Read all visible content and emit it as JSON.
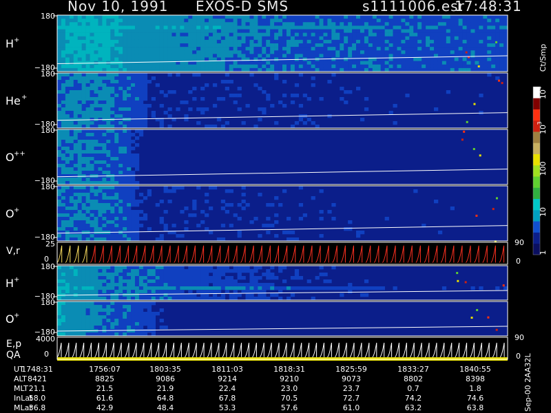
{
  "header": {
    "date": "Nov 10, 1991",
    "instrument": "EXOS-D SMS",
    "file": "s1111006.esr",
    "time": "17:48:31"
  },
  "colors": {
    "background": "#000000",
    "spectrogram_base": "#0b1e8a",
    "dropout": "#2a2aa0"
  },
  "chart_data": {
    "type": "heatmap",
    "panels": [
      {
        "id": "p1",
        "label": "H",
        "sup": "+",
        "ticks": [
          "180",
          "−180"
        ],
        "ylim": [
          -180,
          180
        ],
        "level": [
          [
            0,
            2.1
          ],
          [
            0.02,
            2.6
          ],
          [
            0.1,
            2.7
          ],
          [
            0.15,
            2.2
          ],
          [
            0.19,
            1.9
          ],
          [
            0.27,
            1.8
          ],
          [
            0.4,
            1.6
          ],
          [
            0.5,
            1.4
          ],
          [
            1,
            1.2
          ]
        ],
        "bands": [
          {
            "c": 0.11,
            "w": 0.12,
            "r0": 0.16,
            "r1": 0.67,
            "a": 1.0
          },
          {
            "c": 0.85,
            "w": 0.12,
            "r0": 0.16,
            "r1": 0.67,
            "a": 1.0
          }
        ]
      },
      {
        "id": "p2",
        "label": "He",
        "sup": "+",
        "ticks": [
          "180",
          "−180"
        ],
        "ylim": [
          -180,
          180
        ],
        "level": [
          [
            0,
            1.6
          ],
          [
            0.1,
            1.7
          ],
          [
            0.15,
            1.3
          ],
          [
            0.19,
            1.1
          ],
          [
            0.2,
            0.5
          ],
          [
            1,
            0.4
          ]
        ],
        "bands": [
          {
            "c": 0.12,
            "w": 0.11,
            "r0": 0.45,
            "r1": 0.72,
            "a": 0.8
          },
          {
            "c": 0.86,
            "w": 0.11,
            "r0": 0.45,
            "r1": 0.72,
            "a": 0.8
          }
        ]
      },
      {
        "id": "p3",
        "label": "O",
        "sup": "++",
        "ticks": [
          "180",
          "−180"
        ],
        "ylim": [
          -180,
          180
        ],
        "level": [
          [
            0,
            1.6
          ],
          [
            0.1,
            1.5
          ],
          [
            0.15,
            1.3
          ],
          [
            0.19,
            0.4
          ],
          [
            1,
            0.3
          ]
        ],
        "bands": []
      },
      {
        "id": "p4",
        "label": "O",
        "sup": "+",
        "ticks": [
          "180",
          "−180"
        ],
        "ylim": [
          -180,
          180
        ],
        "level": [
          [
            0,
            1.5
          ],
          [
            0.1,
            1.6
          ],
          [
            0.15,
            1.3
          ],
          [
            0.19,
            0.5
          ],
          [
            1,
            0.4
          ]
        ],
        "bands": [
          {
            "c": 0.12,
            "w": 0.1,
            "r0": 0.45,
            "r1": 0.68,
            "a": 0.7
          },
          {
            "c": 0.87,
            "w": 0.1,
            "r0": 0.45,
            "r1": 0.68,
            "a": 0.7
          }
        ]
      },
      {
        "id": "p5",
        "label": "H",
        "sup": "+",
        "ticks": [
          "180",
          "−180"
        ],
        "ylim": [
          -180,
          180
        ],
        "level": [
          [
            0,
            2.4
          ],
          [
            0.06,
            2.1
          ],
          [
            0.1,
            1.6
          ],
          [
            0.22,
            1.4
          ],
          [
            0.27,
            1.0
          ],
          [
            0.43,
            0.9
          ],
          [
            0.5,
            0.5
          ],
          [
            1,
            0.3
          ]
        ],
        "bands": [
          {
            "c": 0.15,
            "w": 0.1,
            "r0": 0.45,
            "r1": 0.72,
            "a": 0.6
          },
          {
            "c": 0.62,
            "w": 0.08,
            "r0": 0.45,
            "r1": 0.72,
            "a": 0.6
          }
        ]
      },
      {
        "id": "p6",
        "label": "O",
        "sup": "+",
        "ticks": [
          "180",
          "−180"
        ],
        "ylim": [
          -180,
          180
        ],
        "level": [
          [
            0,
            2.5
          ],
          [
            0.03,
            1.9
          ],
          [
            0.14,
            1.4
          ],
          [
            0.2,
            1.0
          ],
          [
            0.24,
            0.4
          ],
          [
            1,
            0.3
          ]
        ],
        "bands": []
      }
    ],
    "line_panels": [
      {
        "id": "vr",
        "label": "V,r",
        "left_ticks": [
          "25",
          "0"
        ],
        "right_ticks": [
          "90",
          "0"
        ],
        "colors": [
          "#ffe060",
          "#ff3020"
        ]
      },
      {
        "id": "ep",
        "label": "E,p",
        "label2": "QA",
        "left_ticks": [
          "4000",
          "0"
        ],
        "right_ticks": [
          "90",
          "0"
        ],
        "colors": [
          "#ffffff",
          "#ffffff"
        ]
      }
    ],
    "colorbar": {
      "unit": "Ct/Smp",
      "tick_labels": [
        "1",
        "10",
        "100",
        "10",
        "10"
      ],
      "exponents": [
        "",
        "",
        "",
        "3",
        "4"
      ],
      "colors": [
        "#0a0f60",
        "#0b1e8a",
        "#1050d0",
        "#00a0c0",
        "#00c8c8",
        "#30b040",
        "#60d030",
        "#a0e020",
        "#e8e000",
        "#c8b060",
        "#a08040",
        "#d02010",
        "#ff3010",
        "#800000",
        "#ffffff"
      ]
    },
    "x_axis": {
      "label": "UT",
      "ticks": [
        "1748:31",
        "1756:07",
        "1803:35",
        "1811:03",
        "1818:31",
        "1825:59",
        "1833:27",
        "1840:55"
      ]
    },
    "ephemeris": [
      {
        "label": "ALT",
        "values": [
          "8421",
          "8825",
          "9086",
          "9214",
          "9210",
          "9073",
          "8802",
          "8398"
        ]
      },
      {
        "label": "MLT",
        "values": [
          "21.1",
          "21.5",
          "21.9",
          "22.4",
          "23.0",
          "23.7",
          "0.7",
          "1.8"
        ]
      },
      {
        "label": "InLat",
        "values": [
          "58.0",
          "61.6",
          "64.8",
          "67.8",
          "70.5",
          "72.7",
          "74.2",
          "74.6"
        ]
      },
      {
        "label": "MLat",
        "values": [
          "36.8",
          "42.9",
          "48.4",
          "53.3",
          "57.6",
          "61.0",
          "63.2",
          "63.8"
        ]
      }
    ],
    "footer": "Sep-00 2AA32L"
  }
}
